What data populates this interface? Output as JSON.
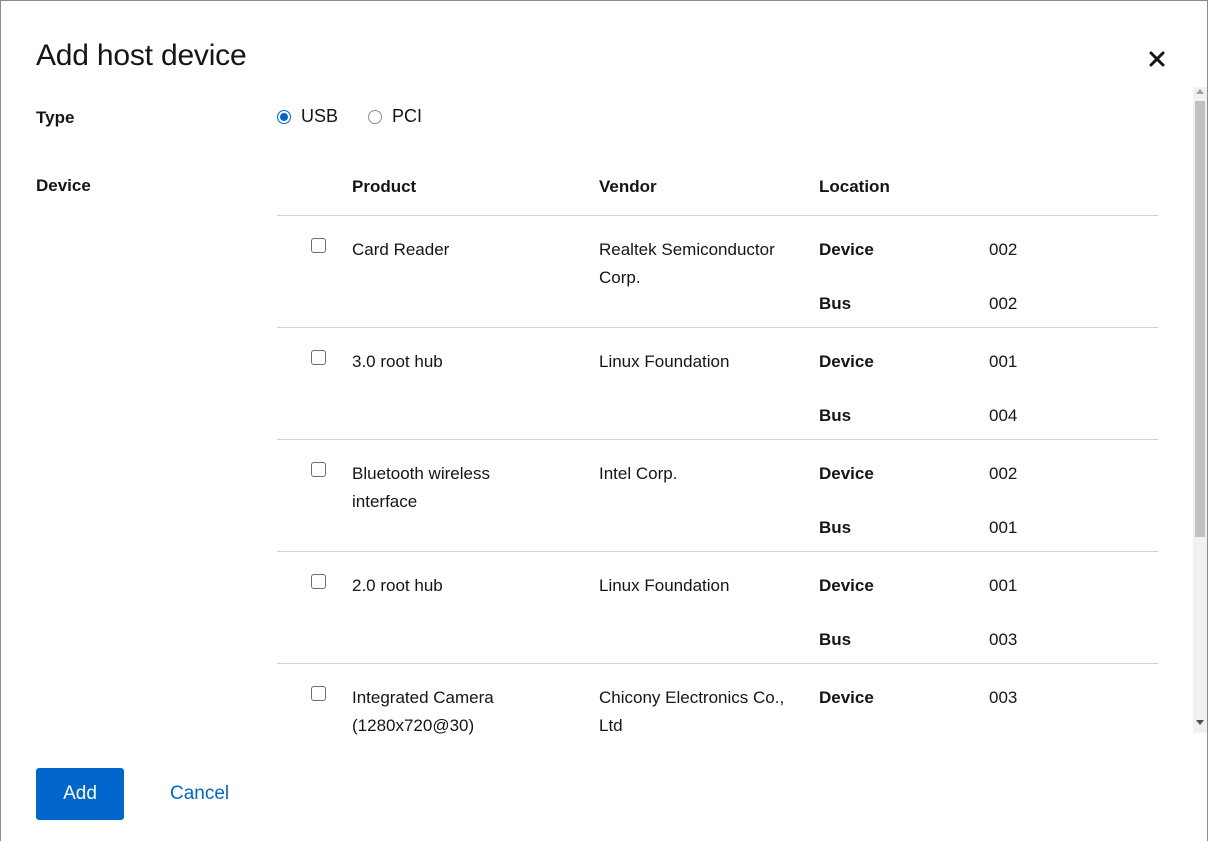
{
  "modal": {
    "title": "Add host device"
  },
  "form": {
    "type_label": "Type",
    "device_label": "Device",
    "type_options": [
      {
        "label": "USB",
        "checked": true
      },
      {
        "label": "PCI",
        "checked": false
      }
    ]
  },
  "table": {
    "headers": {
      "product": "Product",
      "vendor": "Vendor",
      "location": "Location"
    },
    "location_labels": {
      "device": "Device",
      "bus": "Bus"
    },
    "rows": [
      {
        "product": "Card Reader",
        "vendor": "Realtek Semiconductor Corp.",
        "device": "002",
        "bus": "002",
        "checked": false
      },
      {
        "product": "3.0 root hub",
        "vendor": "Linux Foundation",
        "device": "001",
        "bus": "004",
        "checked": false
      },
      {
        "product": "Bluetooth wireless interface",
        "vendor": "Intel Corp.",
        "device": "002",
        "bus": "001",
        "checked": false
      },
      {
        "product": "2.0 root hub",
        "vendor": "Linux Foundation",
        "device": "001",
        "bus": "003",
        "checked": false
      },
      {
        "product": "Integrated Camera (1280x720@30)",
        "vendor": "Chicony Electronics Co., Ltd",
        "device": "003",
        "bus": "",
        "checked": false
      }
    ]
  },
  "footer": {
    "add_label": "Add",
    "cancel_label": "Cancel"
  },
  "icons": {
    "close": "close-icon"
  },
  "colors": {
    "primary": "#0066cc",
    "text": "#151515",
    "border": "#d2d2d2"
  }
}
